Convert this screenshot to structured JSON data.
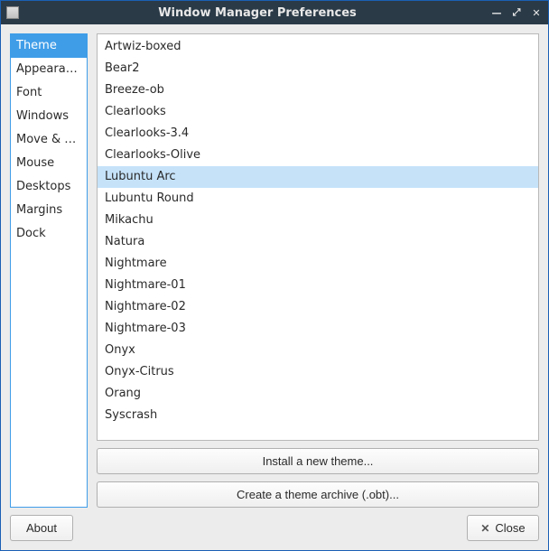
{
  "window": {
    "title": "Window Manager Preferences"
  },
  "sidebar": {
    "items": [
      {
        "label": "Theme",
        "selected": true
      },
      {
        "label": "Appearance",
        "selected": false
      },
      {
        "label": "Font",
        "selected": false
      },
      {
        "label": "Windows",
        "selected": false
      },
      {
        "label": "Move & Resize",
        "selected": false
      },
      {
        "label": "Mouse",
        "selected": false
      },
      {
        "label": "Desktops",
        "selected": false
      },
      {
        "label": "Margins",
        "selected": false
      },
      {
        "label": "Dock",
        "selected": false
      }
    ]
  },
  "themes": {
    "items": [
      {
        "label": "Artwiz-boxed",
        "selected": false
      },
      {
        "label": "Bear2",
        "selected": false
      },
      {
        "label": "Breeze-ob",
        "selected": false
      },
      {
        "label": "Clearlooks",
        "selected": false
      },
      {
        "label": "Clearlooks-3.4",
        "selected": false
      },
      {
        "label": "Clearlooks-Olive",
        "selected": false
      },
      {
        "label": "Lubuntu Arc",
        "selected": true
      },
      {
        "label": "Lubuntu Round",
        "selected": false
      },
      {
        "label": "Mikachu",
        "selected": false
      },
      {
        "label": "Natura",
        "selected": false
      },
      {
        "label": "Nightmare",
        "selected": false
      },
      {
        "label": "Nightmare-01",
        "selected": false
      },
      {
        "label": "Nightmare-02",
        "selected": false
      },
      {
        "label": "Nightmare-03",
        "selected": false
      },
      {
        "label": "Onyx",
        "selected": false
      },
      {
        "label": "Onyx-Citrus",
        "selected": false
      },
      {
        "label": "Orang",
        "selected": false
      },
      {
        "label": "Syscrash",
        "selected": false
      }
    ]
  },
  "buttons": {
    "install_theme": "Install a new theme...",
    "create_archive": "Create a theme archive (.obt)...",
    "about": "About",
    "close": "Close"
  }
}
